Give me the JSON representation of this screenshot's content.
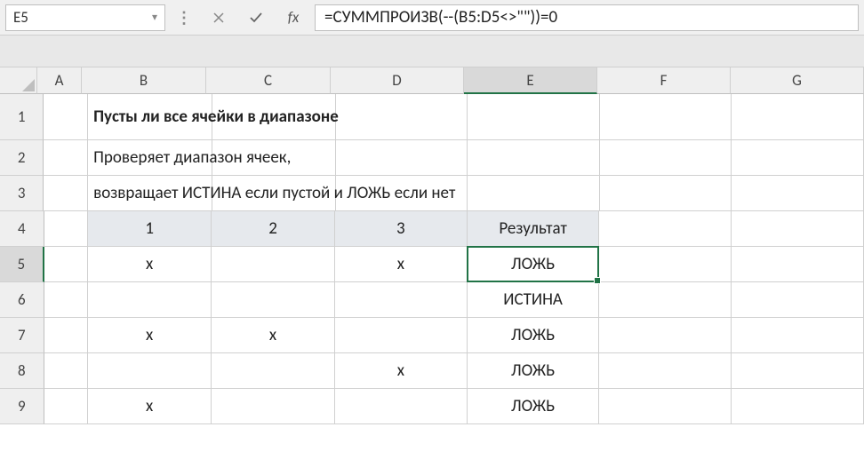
{
  "nameBox": "E5",
  "formula": "=СУММПРОИЗВ(--(B5:D5<>\"\"))=0",
  "fxLabel": "fx",
  "columns": [
    "A",
    "B",
    "C",
    "D",
    "E",
    "F",
    "G"
  ],
  "activeCol": "E",
  "rows": [
    "1",
    "2",
    "3",
    "4",
    "5",
    "6",
    "7",
    "8",
    "9"
  ],
  "activeRow": "5",
  "cells": {
    "B1": "Пусты ли все ячейки в диапазоне",
    "B2": "Проверяет диапазон ячеек,",
    "B3": "возвращает ИСТИНА если пустой и ЛОЖЬ если нет",
    "B4": "1",
    "C4": "2",
    "D4": "3",
    "E4": "Результат",
    "B5": "x",
    "D5": "x",
    "E5": "ЛОЖЬ",
    "E6": "ИСТИНА",
    "B7": "x",
    "C7": "x",
    "E7": "ЛОЖЬ",
    "D8": "x",
    "E8": "ЛОЖЬ",
    "B9": "x",
    "E9": "ЛОЖЬ"
  }
}
